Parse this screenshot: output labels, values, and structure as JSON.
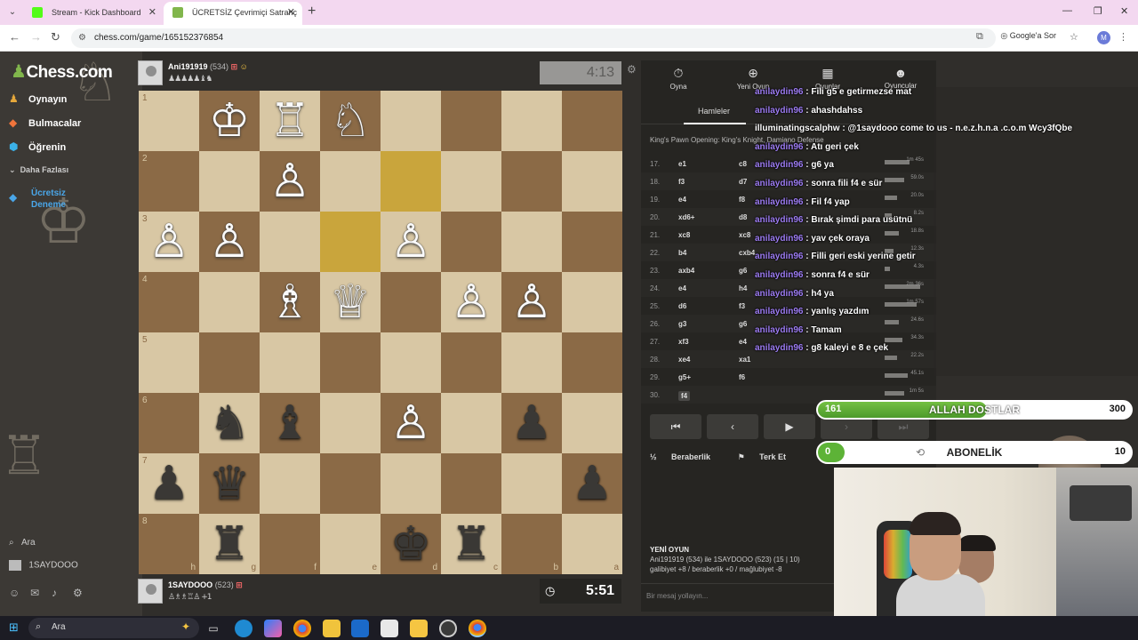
{
  "browser": {
    "tabs": [
      {
        "title": "Stream - Kick Dashboard",
        "active": false,
        "favicon_color": "#53fc18"
      },
      {
        "title": "ÜCRETSİZ Çevrimiçi Satranç",
        "active": true,
        "favicon_color": "#81b64c"
      }
    ],
    "url": "chess.com/game/165152376854",
    "google_sor": "Google'a Sor",
    "profile_initial": "M"
  },
  "sidebar": {
    "logo": "Chess.com",
    "items": [
      {
        "label": "Oynayın",
        "icon": "pawn-icon"
      },
      {
        "label": "Bulmacalar",
        "icon": "puzzle-icon"
      },
      {
        "label": "Öğrenin",
        "icon": "learn-icon"
      }
    ],
    "more": "Daha Fazlası",
    "trial_line1": "Ücretsiz",
    "trial_line2": "Deneme",
    "search": "Ara",
    "user": "1SAYDOOO"
  },
  "game": {
    "top_player": {
      "name": "Ani191919",
      "rating": "(534)",
      "clock": "4:13"
    },
    "bottom_player": {
      "name": "1SAYDOOO",
      "rating": "(523)",
      "clock": "5:51",
      "material": "+1"
    },
    "ranks": [
      "1",
      "2",
      "3",
      "4",
      "5",
      "6",
      "7",
      "8"
    ],
    "files": [
      "h",
      "g",
      "f",
      "e",
      "d",
      "c",
      "b",
      "a"
    ],
    "highlight": [
      [
        2,
        3
      ],
      [
        1,
        4
      ]
    ],
    "pieces": [
      {
        "r": 0,
        "c": 1,
        "p": "♔",
        "w": true
      },
      {
        "r": 0,
        "c": 2,
        "p": "♖",
        "w": true
      },
      {
        "r": 0,
        "c": 3,
        "p": "♘",
        "w": true
      },
      {
        "r": 1,
        "c": 2,
        "p": "♙",
        "w": true
      },
      {
        "r": 2,
        "c": 0,
        "p": "♙",
        "w": true
      },
      {
        "r": 2,
        "c": 1,
        "p": "♙",
        "w": true
      },
      {
        "r": 2,
        "c": 4,
        "p": "♙",
        "w": true
      },
      {
        "r": 3,
        "c": 2,
        "p": "♗",
        "w": true
      },
      {
        "r": 3,
        "c": 3,
        "p": "♕",
        "w": true
      },
      {
        "r": 3,
        "c": 5,
        "p": "♙",
        "w": true
      },
      {
        "r": 3,
        "c": 6,
        "p": "♙",
        "w": true
      },
      {
        "r": 5,
        "c": 1,
        "p": "♞",
        "w": false
      },
      {
        "r": 5,
        "c": 2,
        "p": "♝",
        "w": false
      },
      {
        "r": 5,
        "c": 4,
        "p": "♙",
        "w": true
      },
      {
        "r": 5,
        "c": 6,
        "p": "♟",
        "w": false
      },
      {
        "r": 6,
        "c": 0,
        "p": "♟",
        "w": false
      },
      {
        "r": 6,
        "c": 1,
        "p": "♛",
        "w": false
      },
      {
        "r": 6,
        "c": 7,
        "p": "♟",
        "w": false
      },
      {
        "r": 7,
        "c": 1,
        "p": "♜",
        "w": false
      },
      {
        "r": 7,
        "c": 4,
        "p": "♚",
        "w": false
      },
      {
        "r": 7,
        "c": 5,
        "p": "♜",
        "w": false
      }
    ]
  },
  "panel": {
    "tabs": [
      {
        "label": "Oyna",
        "icon": "play-clock-icon"
      },
      {
        "label": "Yeni Oyun",
        "icon": "new-game-icon"
      },
      {
        "label": "Oyunlar",
        "icon": "games-icon"
      },
      {
        "label": "Oyuncular",
        "icon": "players-icon"
      }
    ],
    "subtab": "Hamleler",
    "opening": "King's Pawn Opening: King's Knight, Damiano Defense",
    "moves": [
      {
        "no": "17.",
        "w": "e1",
        "b": "c8",
        "t": "1m 45s"
      },
      {
        "no": "18.",
        "w": "f3",
        "b": "d7",
        "t": "59.0s"
      },
      {
        "no": "19.",
        "w": "e4",
        "b": "f8",
        "t": "20.0s"
      },
      {
        "no": "20.",
        "w": "xd6+",
        "b": "d8",
        "t": "8.2s"
      },
      {
        "no": "21.",
        "w": "xc8",
        "b": "xc8",
        "t": "18.8s"
      },
      {
        "no": "22.",
        "w": "b4",
        "b": "cxb4",
        "t": "12.3s"
      },
      {
        "no": "23.",
        "w": "axb4",
        "b": "g6",
        "t": "4.3s"
      },
      {
        "no": "24.",
        "w": "e4",
        "b": "h4",
        "t": "2m 36s"
      },
      {
        "no": "25.",
        "w": "d6",
        "b": "f3",
        "t": "1m 57s"
      },
      {
        "no": "26.",
        "w": "g3",
        "b": "g6",
        "t": "24.6s"
      },
      {
        "no": "27.",
        "w": "xf3",
        "b": "e4",
        "t": "34.3s"
      },
      {
        "no": "28.",
        "w": "xe4",
        "b": "xa1",
        "t": "22.2s"
      },
      {
        "no": "29.",
        "w": "g5+",
        "b": "f6",
        "t": "45.1s"
      },
      {
        "no": "30.",
        "w": "f4",
        "b": "",
        "t": "1m 5s"
      }
    ],
    "draw": "Beraberlik",
    "resign": "Terk Et",
    "new_game_title": "YENİ OYUN",
    "new_game_line1": "Ani191919 (534) ile 1SAYDOOO (523) (15 | 10)",
    "new_game_line2": "galibiyet +8 / beraberlik +0 / mağlubiyet -8",
    "message_placeholder": "Bir mesaj yollayın..."
  },
  "chat": [
    {
      "user": "anilaydin96",
      "msg": "Fili g5 e getirmezse mat"
    },
    {
      "user": "anilaydin96",
      "msg": "ahashdahss"
    },
    {
      "user": "illuminatingscalphw",
      "msg": "@1saydooo come to us - n.e.z.h.n.a .c.o.m Wcy3fQbe"
    },
    {
      "user": "anilaydin96",
      "msg": "Atı geri çek"
    },
    {
      "user": "anilaydin96",
      "msg": "g6 ya"
    },
    {
      "user": "anilaydin96",
      "msg": "sonra fili f4 e sür"
    },
    {
      "user": "anilaydin96",
      "msg": "Fil f4 yap"
    },
    {
      "user": "anilaydin96",
      "msg": "Bırak şimdi para usütnü"
    },
    {
      "user": "anilaydin96",
      "msg": "yav çek oraya"
    },
    {
      "user": "anilaydin96",
      "msg": "Filli geri eski yerine getir"
    },
    {
      "user": "anilaydin96",
      "msg": "sonra f4 e sür"
    },
    {
      "user": "anilaydin96",
      "msg": "h4 ya"
    },
    {
      "user": "anilaydin96",
      "msg": "yanlış yazdım"
    },
    {
      "user": "anilaydin96",
      "msg": "Tamam"
    },
    {
      "user": "anilaydin96",
      "msg": "g8 kaleyi e 8 e çek"
    }
  ],
  "goals": {
    "goal1": {
      "current": "161",
      "label": "ALLAH DOSTLAR",
      "target": "300",
      "progress": 0.54
    },
    "goal2": {
      "current": "0",
      "label": "ABONELİK",
      "target": "10",
      "progress": 0.0
    }
  },
  "taskbar": {
    "search": "Ara"
  }
}
